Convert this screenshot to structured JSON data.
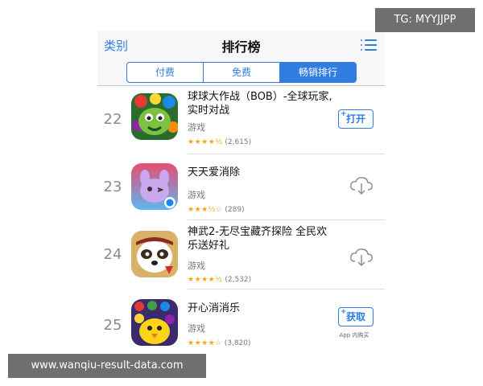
{
  "watermark": {
    "tg": "TG: MYYJJPP",
    "url": "www.wanqiu-result-data.com"
  },
  "navbar": {
    "back_label": "类别",
    "title": "排行榜",
    "menu_icon": "list-icon"
  },
  "segments": [
    {
      "label": "付费",
      "active": false
    },
    {
      "label": "免费",
      "active": false
    },
    {
      "label": "畅销排行",
      "active": true
    }
  ],
  "colors": {
    "accent": "#2f7de1",
    "star": "#f3a712"
  },
  "apps": [
    {
      "rank": "22",
      "name": "球球大作战（BOB）-全球玩家,实时对战",
      "category": "游戏",
      "stars": "★★★★½",
      "rating_count": "(2,615)",
      "action": "打开",
      "action_icon": "plus-icon"
    },
    {
      "rank": "23",
      "name": "天天爱消除",
      "category": "游戏",
      "stars": "★★★½☆",
      "rating_count": "(289)",
      "action_icon": "cloud-download-icon"
    },
    {
      "rank": "24",
      "name": "神武2-无尽宝藏齐探险 全民欢乐送好礼",
      "category": "游戏",
      "stars": "★★★★½",
      "rating_count": "(2,532)",
      "action_icon": "cloud-download-icon"
    },
    {
      "rank": "25",
      "name": "开心消消乐",
      "category": "游戏",
      "stars": "★★★★☆",
      "rating_count": "(3,820)",
      "action": "获取",
      "action_icon": "plus-icon",
      "iap_note": "App 内购买"
    }
  ]
}
